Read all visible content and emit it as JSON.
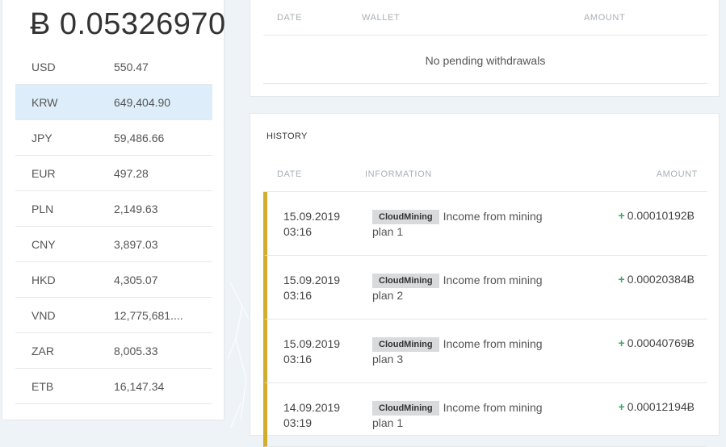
{
  "balance": {
    "symbol": "Ƀ",
    "amount": "0.05326970"
  },
  "rates": [
    {
      "code": "USD",
      "value": "550.47"
    },
    {
      "code": "KRW",
      "value": "649,404.90"
    },
    {
      "code": "JPY",
      "value": "59,486.66"
    },
    {
      "code": "EUR",
      "value": "497.28"
    },
    {
      "code": "PLN",
      "value": "2,149.63"
    },
    {
      "code": "CNY",
      "value": "3,897.03"
    },
    {
      "code": "HKD",
      "value": "4,305.07"
    },
    {
      "code": "VND",
      "value": "12,775,681...."
    },
    {
      "code": "ZAR",
      "value": "8,005.33"
    },
    {
      "code": "ETB",
      "value": "16,147.34"
    }
  ],
  "pending": {
    "columns": {
      "date": "DATE",
      "wallet": "WALLET",
      "amount": "AMOUNT"
    },
    "empty_message": "No pending withdrawals"
  },
  "history": {
    "title": "HISTORY",
    "columns": {
      "date": "DATE",
      "information": "INFORMATION",
      "amount": "AMOUNT"
    },
    "rows": [
      {
        "date": "15.09.2019",
        "time": "03:16",
        "tag": "CloudMining",
        "text": "Income from mining plan 1",
        "sign": "+",
        "amount": "0.00010192Ƀ"
      },
      {
        "date": "15.09.2019",
        "time": "03:16",
        "tag": "CloudMining",
        "text": "Income from mining plan 2",
        "sign": "+",
        "amount": "0.00020384Ƀ"
      },
      {
        "date": "15.09.2019",
        "time": "03:16",
        "tag": "CloudMining",
        "text": "Income from mining plan 3",
        "sign": "+",
        "amount": "0.00040769Ƀ"
      },
      {
        "date": "14.09.2019",
        "time": "03:19",
        "tag": "CloudMining",
        "text": "Income from mining plan 1",
        "sign": "+",
        "amount": "0.00012194Ƀ"
      }
    ]
  },
  "colors": {
    "accent_bar": "#d4ac2b",
    "active_row": "#ddeefa",
    "positive": "#3aa66a"
  }
}
